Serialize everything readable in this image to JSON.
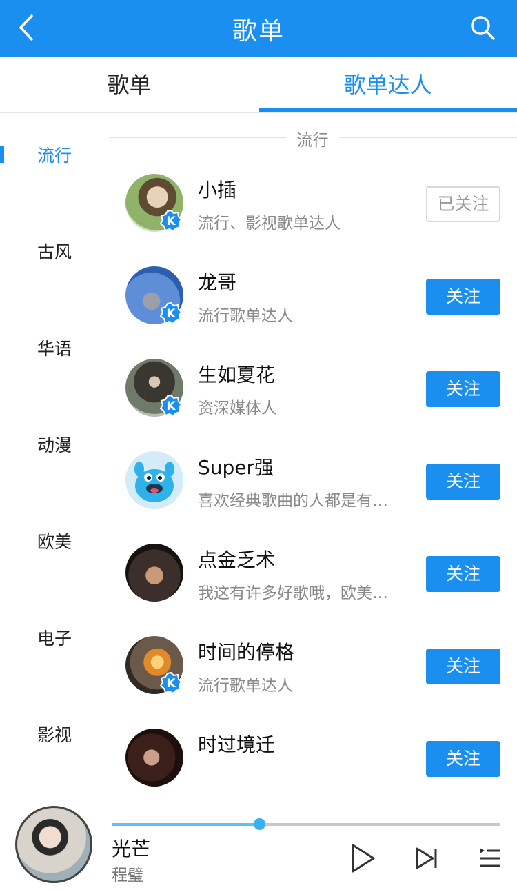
{
  "header": {
    "title": "歌单",
    "back_icon": "chevron-left-icon",
    "search_icon": "search-icon"
  },
  "tabs": [
    {
      "label": "歌单",
      "active": false
    },
    {
      "label": "歌单达人",
      "active": true
    }
  ],
  "colors": {
    "accent": "#1a8ff0",
    "muted": "#8a8a8a",
    "progress": "#5bc0f5"
  },
  "sidebar": {
    "items": [
      {
        "label": "流行",
        "active": true
      },
      {
        "label": "古风"
      },
      {
        "label": "华语"
      },
      {
        "label": "动漫"
      },
      {
        "label": "欧美"
      },
      {
        "label": "电子"
      },
      {
        "label": "影视"
      }
    ]
  },
  "section": {
    "label": "流行"
  },
  "creators": [
    {
      "name": "小插",
      "desc": "流行、影视歌单达人",
      "verified": true,
      "button": "已关注",
      "followed": true
    },
    {
      "name": "龙哥",
      "desc": "流行歌单达人",
      "verified": true,
      "button": "关注",
      "followed": false
    },
    {
      "name": "生如夏花",
      "desc": "资深媒体人",
      "verified": true,
      "button": "关注",
      "followed": false
    },
    {
      "name": "Super强",
      "desc": "喜欢经典歌曲的人都是有…",
      "verified": false,
      "button": "关注",
      "followed": false
    },
    {
      "name": "点金乏术",
      "desc": "我这有许多好歌哦，欧美…",
      "verified": false,
      "button": "关注",
      "followed": false
    },
    {
      "name": "时间的停格",
      "desc": "流行歌单达人",
      "verified": true,
      "button": "关注",
      "followed": false
    },
    {
      "name": "时过境迁",
      "desc": "",
      "verified": false,
      "button": "关注",
      "followed": false
    }
  ],
  "player": {
    "song": "光芒",
    "artist": "程璧",
    "progress": 0.38,
    "icons": [
      "play-icon",
      "next-icon",
      "playlist-icon"
    ]
  }
}
